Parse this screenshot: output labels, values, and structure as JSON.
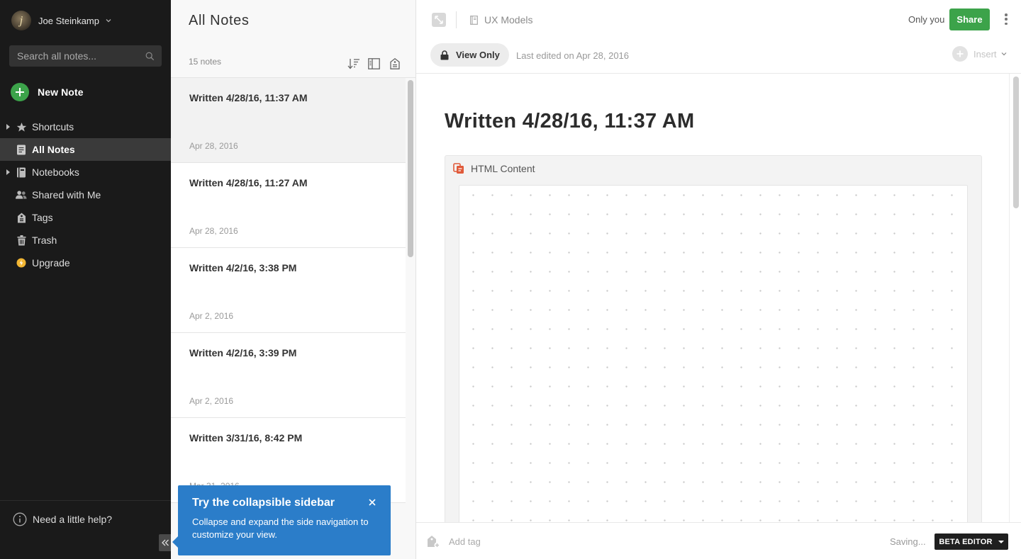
{
  "sidebar": {
    "user_name": "Joe Steinkamp",
    "avatar_letter": "j",
    "search_placeholder": "Search all notes...",
    "new_note_label": "New Note",
    "nav": [
      {
        "label": "Shortcuts",
        "icon": "star-icon",
        "expandable": true
      },
      {
        "label": "All Notes",
        "icon": "notes-icon",
        "active": true
      },
      {
        "label": "Notebooks",
        "icon": "notebook-icon",
        "expandable": true
      },
      {
        "label": "Shared with Me",
        "icon": "people-icon"
      },
      {
        "label": "Tags",
        "icon": "tag-icon"
      },
      {
        "label": "Trash",
        "icon": "trash-icon"
      },
      {
        "label": "Upgrade",
        "icon": "upgrade-icon"
      }
    ],
    "help_label": "Need a little help?"
  },
  "notelist": {
    "title": "All Notes",
    "count": "15 notes",
    "notes": [
      {
        "title": "Written 4/28/16, 11:37 AM",
        "date": "Apr 28, 2016"
      },
      {
        "title": "Written 4/28/16, 11:27 AM",
        "date": "Apr 28, 2016"
      },
      {
        "title": "Written 4/2/16, 3:38 PM",
        "date": "Apr 2, 2016"
      },
      {
        "title": "Written 4/2/16, 3:39 PM",
        "date": "Apr 2, 2016"
      },
      {
        "title": "Written 3/31/16, 8:42 PM",
        "date": "Mar 31, 2016"
      }
    ]
  },
  "popover": {
    "title": "Try the collapsible sidebar",
    "body": "Collapse and expand the side navigation to customize your view."
  },
  "editor": {
    "notebook": "UX Models",
    "sharing_status": "Only you",
    "share_label": "Share",
    "view_only_label": "View Only",
    "last_edited": "Last edited on Apr 28, 2016",
    "insert_label": "Insert",
    "note_title": "Written 4/28/16, 11:37 AM",
    "html_block_label": "HTML Content",
    "add_tag_placeholder": "Add tag",
    "saving_status": "Saving...",
    "beta_label": "BETA EDITOR"
  },
  "colors": {
    "accent_green": "#3ca34a",
    "popover_blue": "#2b7dc9",
    "sidebar_bg": "#1a1a1a",
    "upgrade_yellow": "#f2b633",
    "html_icon_red": "#e05a3a"
  }
}
